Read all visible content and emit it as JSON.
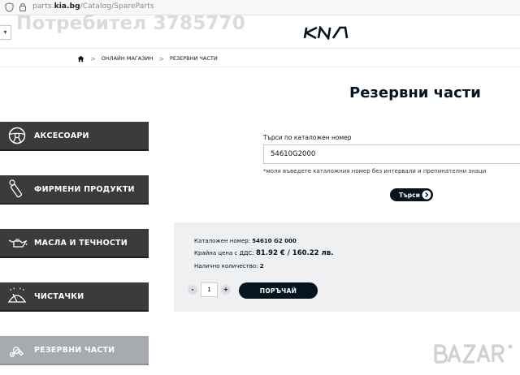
{
  "browser": {
    "url_prefix": "parts.",
    "url_domain": "kia.bg",
    "url_path": "/Catalog/SpareParts"
  },
  "watermark": "Потребител 3785770",
  "lang_select": {
    "value": "▾"
  },
  "breadcrumb": {
    "items": [
      "ОНЛАЙН МАГАЗИН",
      "РЕЗЕРВНИ ЧАСТИ"
    ],
    "separator": ">"
  },
  "page_title": "Резервни части",
  "sidebar": {
    "items": [
      {
        "label": "АКСЕСОАРИ",
        "icon": "steering-wheel-icon"
      },
      {
        "label": "ФИРМЕНИ ПРОДУКТИ",
        "icon": "keychain-tag-icon"
      },
      {
        "label": "МАСЛА И ТЕЧНОСТИ",
        "icon": "oil-can-icon"
      },
      {
        "label": "ЧИСТАЧКИ",
        "icon": "windshield-wiper-icon"
      },
      {
        "label": "РЕЗЕРВНИ ЧАСТИ",
        "icon": "wrench-icon"
      }
    ],
    "active_index": 4
  },
  "search": {
    "label": "Търси по каталожен номер",
    "value": "54610G2000",
    "hint": "*моля въведете каталожния номер без интервали и препинателни знаци",
    "button_label": "Търси"
  },
  "result": {
    "catalog_label": "Каталожен номер:",
    "catalog_value": "54610 G2 000",
    "price_label": "Крайна цена с ДДС:",
    "price_value": "81.92 € / 160.22 лв.",
    "qty_label": "Налично количество:",
    "qty_value": "2",
    "order_qty": "1",
    "minus_label": "-",
    "plus_label": "+",
    "order_button": "ПОРЪЧАЙ"
  },
  "colors": {
    "kia_navy": "#05141f",
    "sidebar_dark": "#3b3b3b",
    "sidebar_active": "#a7abb0",
    "panel_bg": "#eff0f2"
  }
}
